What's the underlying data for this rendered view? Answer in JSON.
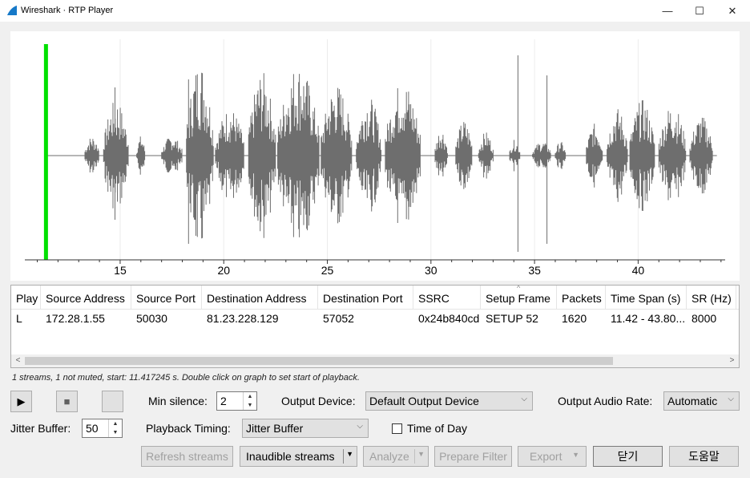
{
  "window": {
    "title": "Wireshark · RTP Player",
    "controls": {
      "minimize": "—",
      "maximize": "☐",
      "close": "✕"
    }
  },
  "graph": {
    "x_ticks": [
      "15",
      "20",
      "25",
      "30",
      "35",
      "40"
    ],
    "x_tick_values": [
      15,
      20,
      25,
      30,
      35,
      40
    ],
    "x_range": [
      10.4,
      44.2
    ],
    "playback_marker_time": 11.42,
    "waveform_color": "#6e6e6e",
    "marker_color": "#00e000"
  },
  "table": {
    "columns": [
      "Play",
      "Source Address",
      "Source Port",
      "Destination Address",
      "Destination Port",
      "SSRC",
      "Setup Frame",
      "Packets",
      "Time Span (s)",
      "SR (Hz)"
    ],
    "sort_indicator": "^",
    "rows": [
      [
        "L",
        "172.28.1.55",
        "50030",
        "81.23.228.129",
        "57052",
        "0x24b840cd",
        "SETUP 52",
        "1620",
        "11.42 - 43.80...",
        "8000"
      ]
    ],
    "scroll_left": "<",
    "scroll_right": ">"
  },
  "status": "1 streams, 1 not muted, start: 11.417245 s. Double click on graph to set start of playback.",
  "controls": {
    "play_icon": "▶",
    "stop_icon": "■",
    "min_silence_label": "Min silence:",
    "min_silence_value": "2",
    "output_device_label": "Output Device:",
    "output_device_value": "Default Output Device",
    "output_rate_label": "Output Audio Rate:",
    "output_rate_value": "Automatic",
    "jitter_label": "Jitter Buffer:",
    "jitter_value": "50",
    "timing_label": "Playback Timing:",
    "timing_value": "Jitter Buffer",
    "time_of_day_label": "Time of Day",
    "time_of_day_checked": false
  },
  "buttons": {
    "refresh": "Refresh streams",
    "inaudible": "Inaudible streams",
    "analyze": "Analyze",
    "prepare_filter": "Prepare Filter",
    "export": "Export",
    "close": "닫기",
    "help": "도움말"
  }
}
